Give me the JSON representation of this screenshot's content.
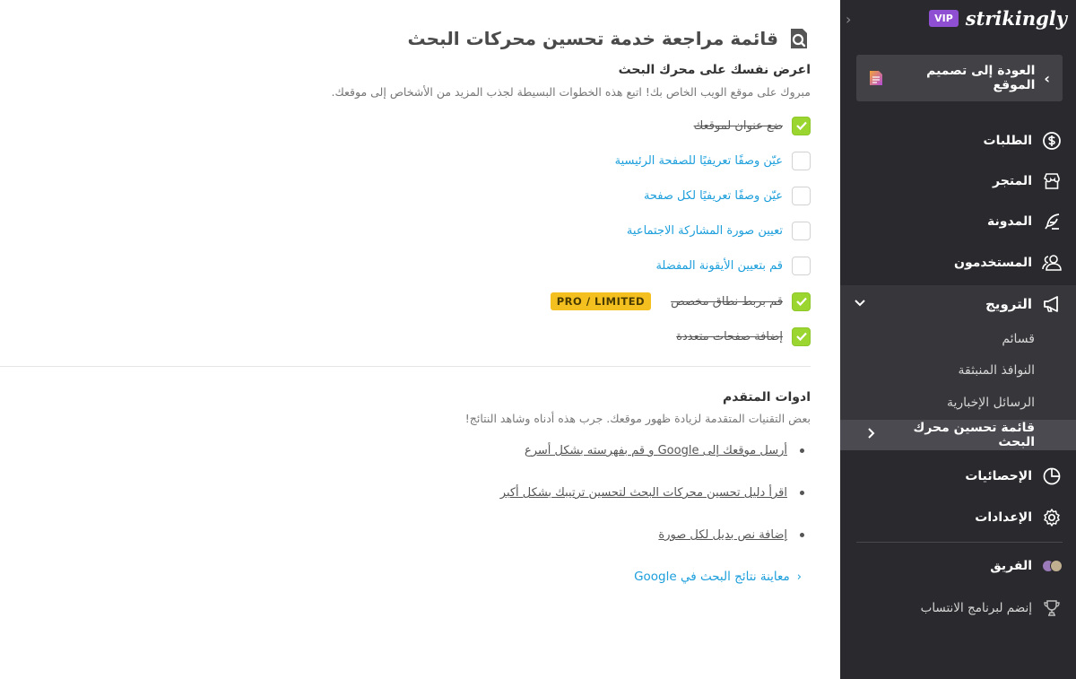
{
  "main": {
    "page_title": "قائمة مراجعة خدمة تحسين محركات البحث",
    "intro": {
      "heading": "اعرض نفسك على محرك البحث",
      "description": "مبروك على موقع الويب الخاص بك! اتبع هذه الخطوات البسيطة لجذب المزيد من الأشخاص إلى موقعك."
    },
    "checklist": [
      {
        "label": "ضع عنوان لموقعك",
        "checked": true
      },
      {
        "label": "عيّن وصفًا تعريفيًا للصفحة الرئيسية",
        "checked": false
      },
      {
        "label": "عيّن وصفًا تعريفيًا لكل صفحة",
        "checked": false
      },
      {
        "label": "تعيين صورة المشاركة الاجتماعية",
        "checked": false
      },
      {
        "label": "قم بتعيين الأيقونة المفضلة",
        "checked": false
      },
      {
        "label": "قم بربط نطاق مخصص",
        "checked": true,
        "badge": "PRO / LIMITED"
      },
      {
        "label": "إضافة صفحات متعددة",
        "checked": true
      }
    ],
    "advanced": {
      "heading": "ادوات المتقدم",
      "description": "بعض التقنيات المتقدمة لزيادة ظهور موقعك. جرب هذه أدناه وشاهد النتائج!",
      "links": [
        "أرسل موقعك إلى Google و قم بفهرسته بشكل أسرع",
        "اقرأ دليل تحسين محركات البحث لتحسين ترتيبك بشكل أكبر",
        "إضافة نص بديل لكل صورة"
      ],
      "preview_link": "معاينة نتائج البحث في Google"
    }
  },
  "sidebar": {
    "brand": "strikingly",
    "vip": "VIP",
    "back_label": "العودة إلى تصميم الموقع",
    "nav": {
      "orders": "الطلبات",
      "store": "المتجر",
      "blog": "المدونة",
      "users": "المستخدمون",
      "promote": "الترويج",
      "coupons": "قسائم",
      "popups": "النوافذ المنبثقة",
      "newsletters": "الرسائل الإخبارية",
      "seo_checklist": "قائمة تحسين محرك البحث",
      "analytics": "الإحصائيات",
      "settings": "الإعدادات",
      "team": "الفريق",
      "affiliate": "إنضم لبرنامج الانتساب"
    }
  },
  "colors": {
    "sidebar_bg": "#2a2a2e",
    "accent_link": "#1b9edb",
    "check_green": "#9bd52f",
    "badge_yellow": "#f4c020",
    "vip_purple": "#8e4fd2"
  }
}
